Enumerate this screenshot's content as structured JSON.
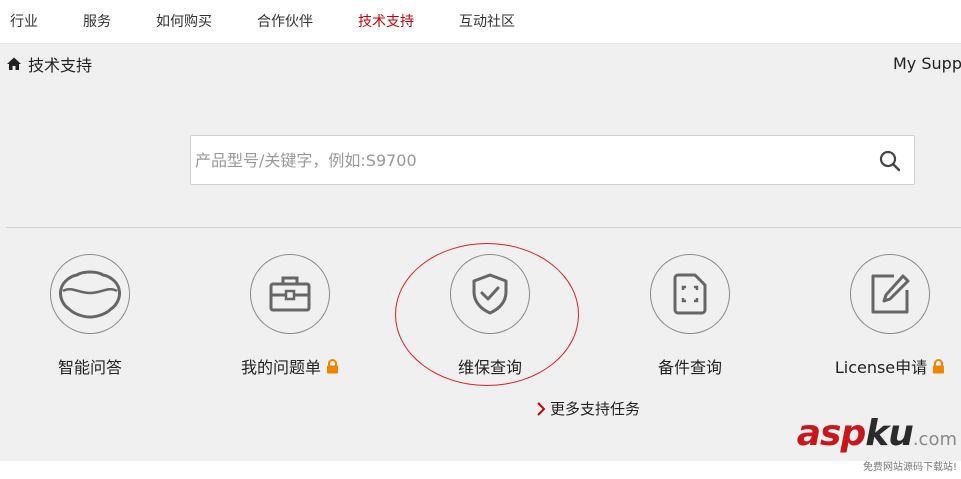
{
  "nav": {
    "items": [
      {
        "label": "行业"
      },
      {
        "label": "服务"
      },
      {
        "label": "如何购买"
      },
      {
        "label": "合作伙伴"
      },
      {
        "label": "技术支持",
        "active": true
      },
      {
        "label": "互动社区"
      }
    ],
    "active_color": "#c7000b"
  },
  "breadcrumb": {
    "icon": "home-icon",
    "label": "技术支持"
  },
  "my_support": "My Supp",
  "search": {
    "placeholder": "产品型号/关键字，例如:S9700",
    "value": "",
    "icon": "search-icon"
  },
  "services": [
    {
      "label": "智能问答",
      "icon": "chat-bubble-icon",
      "locked": false
    },
    {
      "label": "我的问题单",
      "icon": "toolbox-icon",
      "locked": true
    },
    {
      "label": "维保查询",
      "icon": "shield-check-icon",
      "locked": false,
      "highlighted": true
    },
    {
      "label": "备件查询",
      "icon": "sd-card-icon",
      "locked": false
    },
    {
      "label": "License申请",
      "icon": "edit-icon",
      "locked": true
    }
  ],
  "more_tasks": {
    "label": "更多支持任务",
    "icon": "chevron-right-icon"
  },
  "lock_color": "#f08300",
  "annotation_color": "#e02020",
  "watermark": {
    "main_a": "asp",
    "main_b": "ku",
    "main_c": ".com",
    "sub": "免费网站源码下载站!"
  }
}
